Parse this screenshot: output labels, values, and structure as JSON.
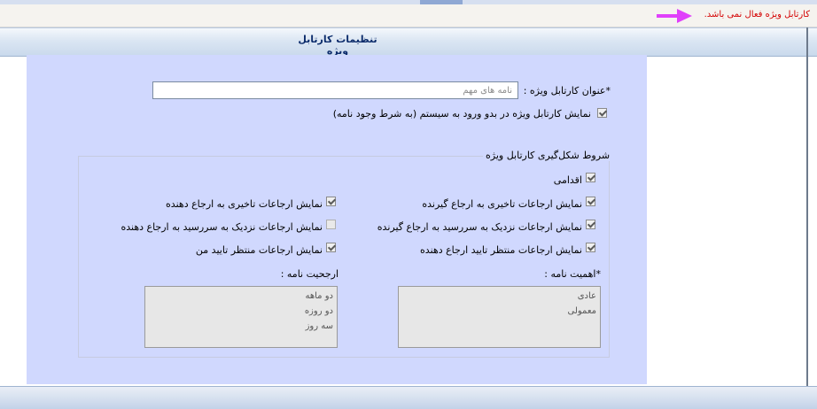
{
  "notice": {
    "text": "کارتابل ویژه فعال نمی باشد."
  },
  "header": {
    "title": "تنظیمات کارتابل ویژه"
  },
  "form": {
    "title_label": "*عنوان کارتابل ویژه :",
    "title_value": "نامه های مهم",
    "show_on_login_label": "نمایش کارتابل ویژه در بدو ورود به سیستم (به شرط وجود نامه)",
    "show_on_login_checked": true
  },
  "conditions": {
    "legend": "شروط شکل‌گیری کارتابل ویژه",
    "action_label": "اقدامی",
    "right_items": [
      {
        "label": "نمایش ارجاعات تاخیری به ارجاع گیرنده",
        "checked": true
      },
      {
        "label": "نمایش ارجاعات نزدیک به سررسید به ارجاع گیرنده",
        "checked": true
      },
      {
        "label": "نمایش ارجاعات منتظر تایید ارجاع دهنده",
        "checked": true
      }
    ],
    "left_items": [
      {
        "label": "نمایش ارجاعات تاخیری به ارجاع دهنده",
        "checked": true
      },
      {
        "label": "نمایش ارجاعات نزدیک به سررسید به ارجاع دهنده",
        "checked": false
      },
      {
        "label": "نمایش ارجاعات منتظر تایید من",
        "checked": true
      }
    ],
    "importance_label": "*اهمیت نامه :",
    "importance_options": [
      "عادی",
      "معمولی"
    ],
    "priority_label": "ارجحیت نامه :",
    "priority_options": [
      "دو ماهه",
      "دو روزه",
      "سه روز"
    ]
  },
  "colors": {
    "notice": "#d40000",
    "arrow": "#e040fb",
    "panel": "#d0d8fe",
    "header_text": "#0d2d6c"
  },
  "icons": {
    "notice_arrow": "arrow-right-icon",
    "checkbox_check": "checkmark-icon"
  }
}
